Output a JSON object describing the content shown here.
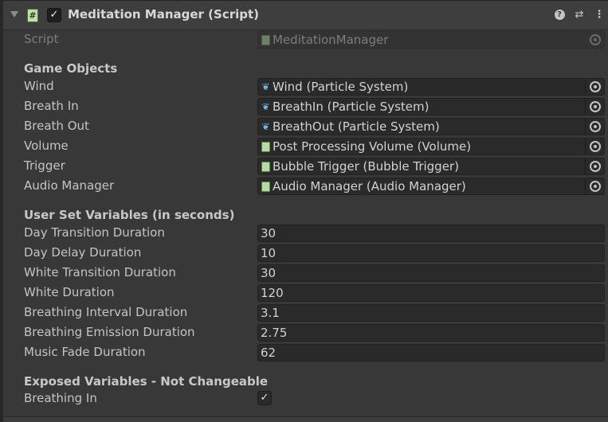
{
  "component": {
    "title": "Meditation Manager (Script)",
    "enabled_mark": "✓",
    "script_icon_glyph": "#",
    "header_buttons": {
      "help": "?",
      "presets": "⇄",
      "menu": "⋮"
    }
  },
  "script_row": {
    "label": "Script",
    "value": "MeditationManager"
  },
  "game_objects": {
    "header": "Game Objects",
    "fields": [
      {
        "label": "Wind",
        "value": "Wind (Particle System)",
        "icon": "particle-system-icon"
      },
      {
        "label": "Breath In",
        "value": "BreathIn (Particle System)",
        "icon": "particle-system-icon"
      },
      {
        "label": "Breath Out",
        "value": "BreathOut (Particle System)",
        "icon": "particle-system-icon"
      },
      {
        "label": "Volume",
        "value": "Post Processing Volume (Volume)",
        "icon": "script-icon"
      },
      {
        "label": "Trigger",
        "value": "Bubble Trigger (Bubble Trigger)",
        "icon": "script-icon"
      },
      {
        "label": "Audio Manager",
        "value": "Audio Manager (Audio Manager)",
        "icon": "script-icon"
      }
    ]
  },
  "user_variables": {
    "header": "User Set Variables (in seconds)",
    "fields": [
      {
        "label": "Day Transition Duration",
        "value": "30"
      },
      {
        "label": "Day Delay Duration",
        "value": "10"
      },
      {
        "label": "White Transition Duration",
        "value": "30"
      },
      {
        "label": "White Duration",
        "value": "120"
      },
      {
        "label": "Breathing Interval Duration",
        "value": "3.1"
      },
      {
        "label": "Breathing Emission Duration",
        "value": "2.75"
      },
      {
        "label": "Music Fade Duration",
        "value": "62"
      }
    ]
  },
  "exposed_variables": {
    "header": "Exposed Variables - Not Changeable",
    "breathing_in": {
      "label": "Breathing In",
      "checked": true,
      "mark": "✓"
    }
  },
  "particle_glyph": "❦",
  "colors": {
    "background": "#383838",
    "field": "#2a2a2a",
    "particle_icon": "#6fb8e8",
    "script_icon": "#b8d8a8"
  }
}
